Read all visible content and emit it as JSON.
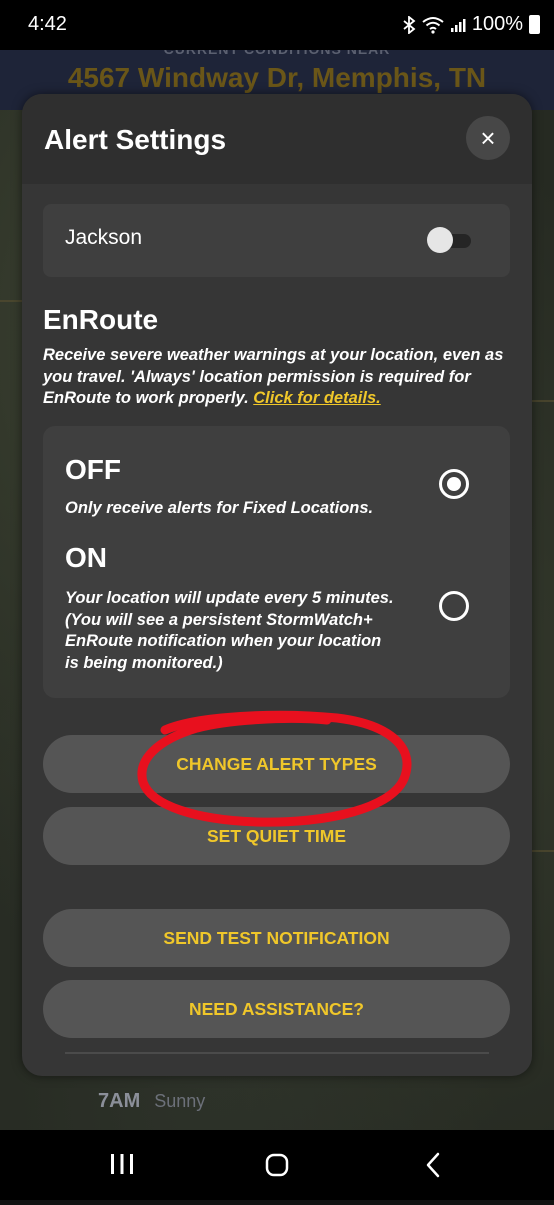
{
  "status_bar": {
    "time": "4:42",
    "battery": "100%"
  },
  "background": {
    "header_subtitle": "CURRENT CONDITIONS NEAR",
    "address": "4567 Windway Dr, Memphis, TN",
    "forecast_time": "7AM",
    "forecast_condition": "Sunny"
  },
  "modal": {
    "title": "Alert Settings",
    "close_icon": "×",
    "location": {
      "name": "Jackson",
      "enabled": false
    },
    "enroute": {
      "title": "EnRoute",
      "description": "Receive severe weather warnings at your location, even as you travel.  'Always' location permission is required for EnRoute to work properly. ",
      "link_text": "Click for details.",
      "options": [
        {
          "title": "OFF",
          "description": "Only receive alerts for Fixed Locations.",
          "selected": true
        },
        {
          "title": "ON",
          "description": "Your location will update every 5 minutes. (You will see a persistent StormWatch+ EnRoute notification when your location is being monitored.)",
          "selected": false
        }
      ]
    },
    "buttons": {
      "change_alert_types": "CHANGE ALERT TYPES",
      "set_quiet_time": "SET QUIET TIME",
      "send_test_notification": "SEND TEST NOTIFICATION",
      "need_assistance": "NEED ASSISTANCE?"
    }
  },
  "colors": {
    "accent": "#f0c72a",
    "modal_bg": "#363636",
    "card_bg": "#3f3f3f",
    "button_bg": "#555555",
    "annotation": "#e8101e"
  },
  "icons": {
    "status_right": [
      "bluetooth-icon",
      "wifi-icon",
      "signal-icon",
      "battery-icon"
    ],
    "nav": [
      "recent-apps-icon",
      "home-icon",
      "back-icon"
    ]
  }
}
